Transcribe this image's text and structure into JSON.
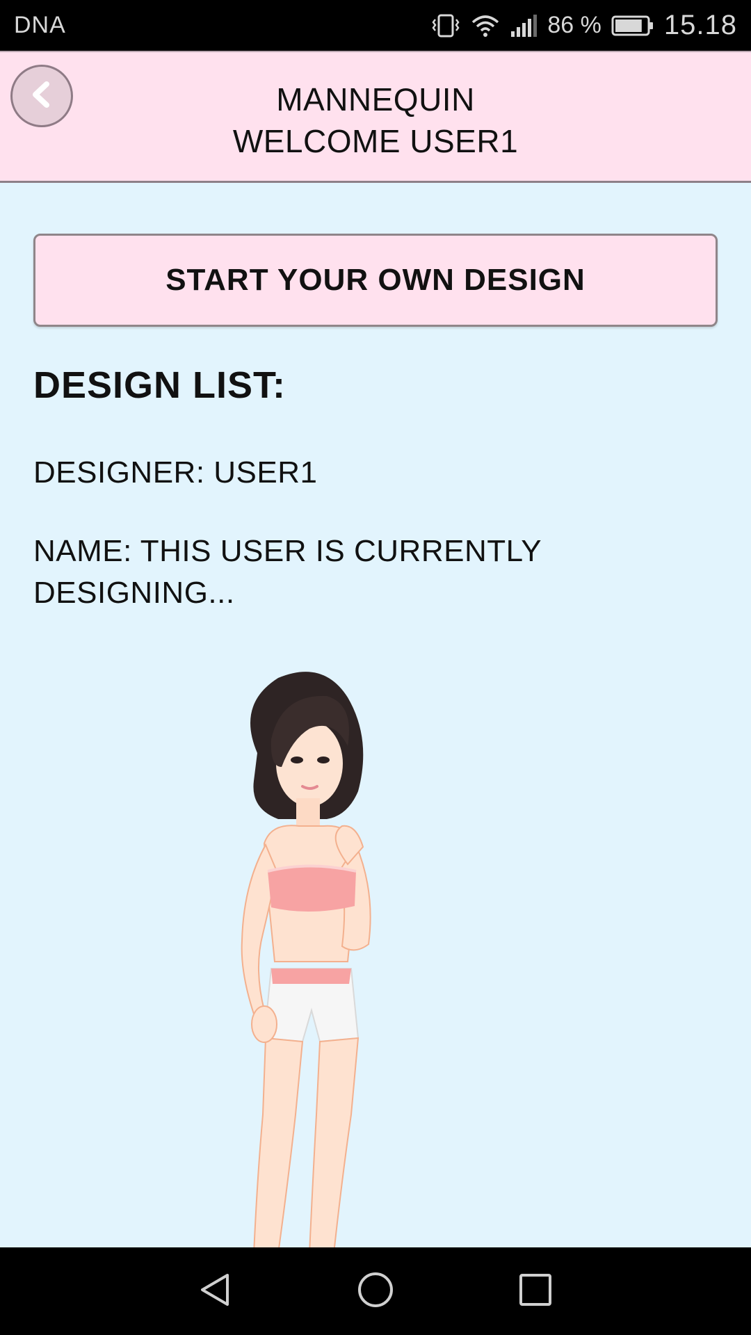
{
  "status_bar": {
    "carrier": "DNA",
    "battery_percent": "86 %",
    "time": "15.18",
    "battery_level": 0.86
  },
  "header": {
    "title_line1": "MANNEQUIN",
    "title_line2": "WELCOME USER1",
    "background": "#ffe1ee"
  },
  "main": {
    "start_button_label": "START YOUR OWN DESIGN",
    "list_heading": "DESIGN LIST:",
    "designer_line": "DESIGNER: USER1",
    "name_line": "NAME: THIS USER IS CURRENTLY DESIGNING...",
    "background": "#e2f4fd"
  },
  "icons": {
    "back": "chevron-left-icon",
    "vibrate": "vibrate-icon",
    "wifi": "wifi-icon",
    "signal": "signal-icon",
    "battery": "battery-icon",
    "nav_back": "triangle-back-icon",
    "nav_home": "circle-home-icon",
    "nav_recents": "square-recents-icon"
  }
}
